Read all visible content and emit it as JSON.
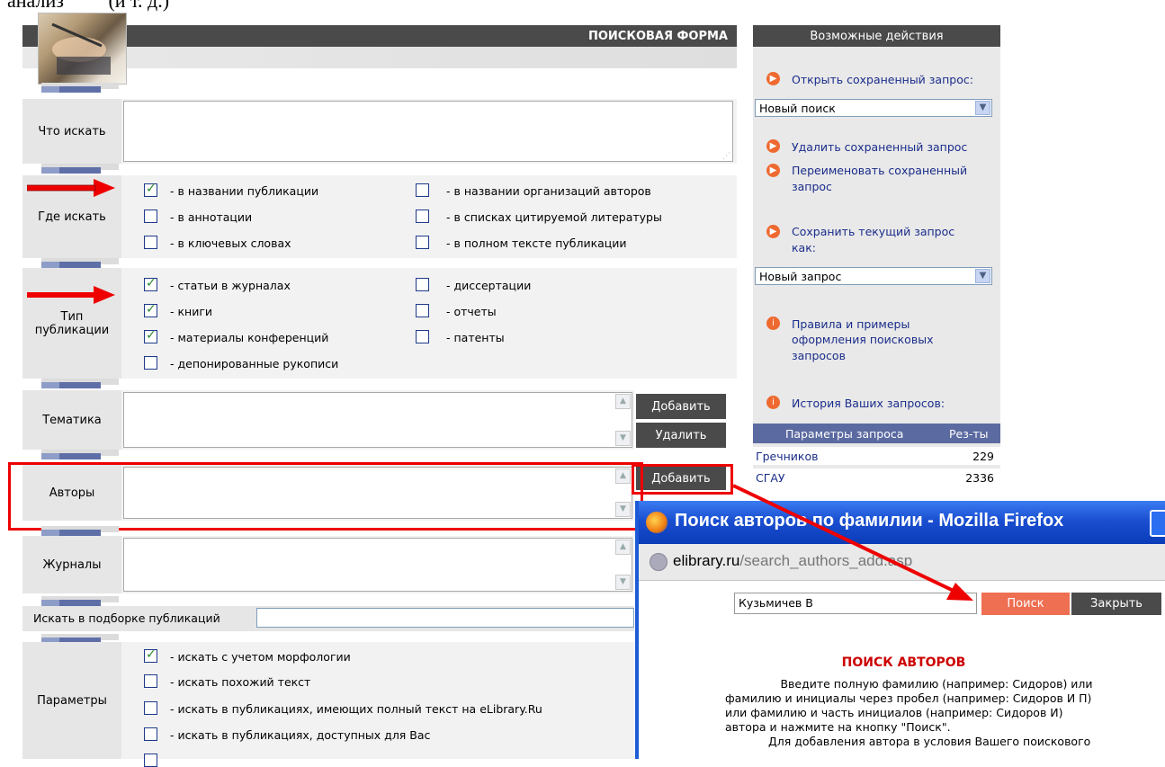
{
  "top_caption": "анализ         (и т. д.)",
  "form": {
    "title": "ПОИСКОВАЯ ФОРМА",
    "what_label": "Что искать",
    "where_label": "Где искать",
    "where_options_left": [
      {
        "label": "- в названии публикации",
        "checked": true
      },
      {
        "label": "- в аннотации",
        "checked": false
      },
      {
        "label": "- в ключевых словах",
        "checked": false
      }
    ],
    "where_options_right": [
      {
        "label": "- в названии организаций авторов",
        "checked": false
      },
      {
        "label": "- в списках цитируемой литературы",
        "checked": false
      },
      {
        "label": "- в полном тексте публикации",
        "checked": false
      }
    ],
    "type_label_1": "Тип",
    "type_label_2": "публикации",
    "type_options_left": [
      {
        "label": "- статьи в журналах",
        "checked": true
      },
      {
        "label": "- книги",
        "checked": true
      },
      {
        "label": "- материалы конференций",
        "checked": true
      },
      {
        "label": "- депонированные рукописи",
        "checked": false
      }
    ],
    "type_options_right": [
      {
        "label": "- диссертации",
        "checked": false
      },
      {
        "label": "- отчеты",
        "checked": false
      },
      {
        "label": "- патенты",
        "checked": false
      }
    ],
    "topic_label": "Тематика",
    "add_label": "Добавить",
    "delete_label": "Удалить",
    "authors_label": "Авторы",
    "journals_label": "Журналы",
    "collection_label": "Искать в подборке публикаций",
    "params_label": "Параметры",
    "params_options": [
      {
        "label": "- искать с учетом морфологии",
        "checked": true
      },
      {
        "label": "- искать похожий текст",
        "checked": false
      },
      {
        "label": "- искать в публикациях, имеющих полный текст на eLibrary.Ru",
        "checked": false
      },
      {
        "label": "- искать в публикациях, доступных для Вас",
        "checked": false
      }
    ]
  },
  "sidebar": {
    "title": "Возможные действия",
    "open_saved": "Открыть сохраненный запрос:",
    "select_saved_value": "Новый поиск",
    "delete_saved": "Удалить сохраненный запрос",
    "rename_saved_1": "Переименовать сохраненный",
    "rename_saved_2": "запрос",
    "save_current_1": "Сохранить текущий запрос",
    "save_current_2": "как:",
    "select_new_value": "Новый запрос",
    "rules_1": "Правила и примеры",
    "rules_2": "оформления поисковых",
    "rules_3": "запросов",
    "history": "История Ваших запросов:",
    "history_col_params": "Параметры запроса",
    "history_col_results": "Рез-ты",
    "history_rows": [
      {
        "query": "Гречников",
        "results": "229"
      },
      {
        "query": "СГАУ",
        "results": "2336"
      }
    ]
  },
  "popup": {
    "title": "Поиск авторов по фамилии - Mozilla Firefox",
    "url_host": "elibrary.ru",
    "url_path": "/search_authors_add.asp",
    "search_value": "Кузьмичев В",
    "search_button": "Поиск",
    "close_button": "Закрыть",
    "heading": "ПОИСК АВТОРОВ",
    "instructions": [
      "Введите полную фамилию (например: Сидоров) или",
      "фамилию и инициалы через пробел (например: Сидоров И П)",
      "или фамилию и часть инициалов (например: Сидоров И)",
      "автора и нажмите на кнопку \"Поиск\".",
      "Для добавления автора в условия Вашего поискового"
    ]
  },
  "colors": {
    "header_bg": "#4a4a4a",
    "accent_orange": "#ee6a30",
    "annotation_red": "#e00000",
    "link_blue": "#1a2d8a",
    "heading_red": "#cc0000"
  }
}
